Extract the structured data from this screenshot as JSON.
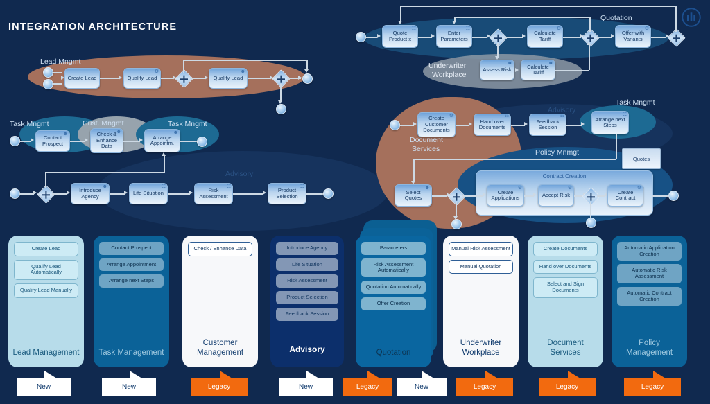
{
  "header": {
    "title": "INTEGRATION ARCHITECTURE",
    "logo_icon": "allianz-bars-logo"
  },
  "colors": {
    "background": "#10294f",
    "legacy": "#f26a0f",
    "new": "#ffffff",
    "brown_pool": "#a5705c",
    "teal_pool": "#1d6a93",
    "grey_pool": "#97a3ad"
  },
  "diagram": {
    "pool_labels": [
      {
        "name": "lead-mngmt",
        "text": "Lead Mngmt"
      },
      {
        "name": "task-mngmt-1",
        "text": "Task Mngmt"
      },
      {
        "name": "cust-mngmt",
        "text": "Cust. Mngmt"
      },
      {
        "name": "task-mngmt-2",
        "text": "Task Mngmt"
      },
      {
        "name": "advisory-faint",
        "text": "Advisory"
      },
      {
        "name": "quotation",
        "text": "Quotation"
      },
      {
        "name": "underwriter-workplace",
        "text": "Underwriter\nWorkplace"
      },
      {
        "name": "document-services",
        "text": "Document\nServices"
      },
      {
        "name": "task-mngmt-3",
        "text": "Task Mngmt"
      },
      {
        "name": "policy-mnmgt",
        "text": "Policy Mnmgt"
      },
      {
        "name": "advisory-faint-2",
        "text": "Advisory"
      }
    ],
    "underwriter_line1": "Underwriter",
    "underwriter_line2": "Workplace",
    "document_line1": "Document",
    "document_line2": "Services",
    "lead_lane": {
      "label": "Lead Mngmt"
    },
    "tasks": {
      "create_lead": "Create Lead",
      "qualify_lead_auto": "Qualify Lead",
      "qualify_lead_manual": "Qualify Lead",
      "contact_prospect": "Contact Prospect",
      "check_enhance_data": "Check & Enhance Data",
      "arrange_appointm": "Arrange Appointm.",
      "introduce_agency": "Introduce Agency",
      "life_situation": "Life Situation",
      "risk_assessment": "Risk Assessment",
      "product_selection": "Product Selection",
      "quote_product_x": "Quote Product x",
      "enter_parameters": "Enter Parameters",
      "calculate_tariff": "Calculate Tariff",
      "offer_with_variants": "Offer with Variants",
      "assess_risk": "Assess Risk",
      "calculate_tariff_uw": "Calculate Tariff",
      "create_customer_documents": "Create Customer Documents",
      "hand_over_documents": "Hand over Documents",
      "feedback_session": "Feedback Session",
      "arrange_next_steps": "Arrange next Steps",
      "select_quotes": "Select Quotes",
      "create_applications": "Create Applications",
      "accept_risk": "Accept Risk",
      "create_contract": "Create Contract"
    },
    "subprocess_title": "Contract Creation",
    "data_object": "Quotes"
  },
  "cards": [
    {
      "name": "lead-management",
      "title": "Lead Management",
      "items": [
        "Create Lead",
        "Qualify Lead Automatically",
        "Qualify Lead Manually"
      ],
      "banners": [
        {
          "label": "New",
          "type": "new"
        }
      ]
    },
    {
      "name": "task-management",
      "title": "Task Management",
      "items": [
        "Contact Prospect",
        "Arrange Appointment",
        "Arrange next Steps"
      ],
      "banners": [
        {
          "label": "New",
          "type": "new"
        }
      ]
    },
    {
      "name": "customer-management",
      "title": "Customer Management",
      "items": [
        "Check / Enhance Data"
      ],
      "banners": [
        {
          "label": "Legacy",
          "type": "legacy"
        }
      ]
    },
    {
      "name": "advisory",
      "title": "Advisory",
      "items": [
        "Introduce Agency",
        "Life Situation",
        "Risk Assessment",
        "Product Selection",
        "Feedback Session"
      ],
      "banners": [
        {
          "label": "New",
          "type": "new"
        }
      ]
    },
    {
      "name": "quotation",
      "title": "Quotation",
      "items": [
        "Parameters",
        "Risk Assessment Automatically",
        "Quotation Automatically",
        "Offer Creation"
      ],
      "banners": [
        {
          "label": "Legacy",
          "type": "legacy"
        },
        {
          "label": "New",
          "type": "new"
        }
      ]
    },
    {
      "name": "underwriter-workplace",
      "title": "Underwriter Workplace",
      "items": [
        "Manual Risk Assessment",
        "Manual Quotation"
      ],
      "banners": [
        {
          "label": "Legacy",
          "type": "legacy"
        }
      ]
    },
    {
      "name": "document-services",
      "title": "Document Services",
      "items": [
        "Create Documents",
        "Hand over Documents",
        "Select and Sign Documents"
      ],
      "banners": [
        {
          "label": "Legacy",
          "type": "legacy"
        }
      ]
    },
    {
      "name": "policy-management",
      "title": "Policy Management",
      "items": [
        "Automatic Application Creation",
        "Automatic Risk Assessment",
        "Automatic Contract Creation"
      ],
      "banners": [
        {
          "label": "Legacy",
          "type": "legacy"
        }
      ]
    }
  ]
}
